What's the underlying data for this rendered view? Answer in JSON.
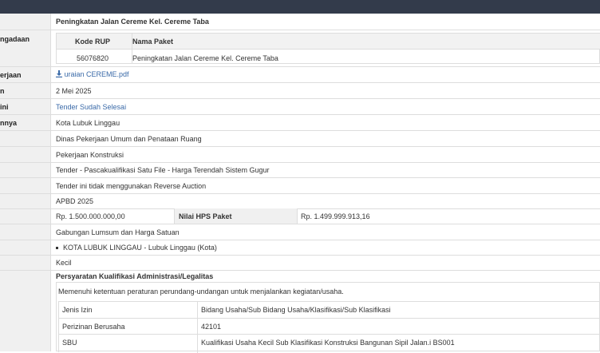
{
  "rows": {
    "nama_paket": "Peningkatan Jalan Cereme Kel. Cereme Taba",
    "rup_label": "ngadaan",
    "kode_rup_header": "Kode RUP",
    "nama_paket_header": "Nama Paket",
    "kode_rup_value": "56076820",
    "nama_paket_value": "Peningkatan Jalan Cereme Kel. Cereme Taba",
    "uraian_label": "erjaan",
    "uraian_file": "uraian CEREME.pdf",
    "tanggal_label": "n",
    "tanggal": "2 Mei 2025",
    "tahap_label": "ini",
    "tahap": "Tender Sudah Selesai",
    "instansi_label": "nnya",
    "instansi": "Kota Lubuk Linggau",
    "satker": "Dinas Pekerjaan Umum dan Penataan Ruang",
    "kategori": "Pekerjaan Konstruksi",
    "metode": "Tender - Pascakualifikasi Satu File - Harga Terendah Sistem Gugur",
    "reverse": "Tender ini tidak menggunakan Reverse Auction",
    "anggaran": "APBD 2025",
    "pagu": "Rp. 1.500.000.000,00",
    "hps_label": "Nilai HPS Paket",
    "hps": "Rp. 1.499.999.913,16",
    "kontrak": "Gabungan Lumsum dan Harga Satuan",
    "lokasi": "KOTA LUBUK LINGGAU - Lubuk Linggau (Kota)",
    "kualifikasi_usaha": "Kecil"
  },
  "syarat": {
    "title": "Persyaratan Kualifikasi Administrasi/Legalitas",
    "desc": "Memenuhi ketentuan peraturan perundang-undangan untuk menjalankan kegiatan/usaha.",
    "table": [
      {
        "col1": "Jenis Izin",
        "col2": "Bidang Usaha/Sub Bidang Usaha/Klasifikasi/Sub Klasifikasi"
      },
      {
        "col1": "Perizinan Berusaha",
        "col2": "42101"
      },
      {
        "col1": "SBU",
        "col2": "Kualifikasi Usaha Kecil Sub Klasifikasi Konstruksi Bangunan Sipil Jalan.i BS001"
      }
    ]
  },
  "colors": {
    "topbar": "#333b4b",
    "link": "#3a6aa8",
    "label_bg": "#f0f0f0",
    "border": "#dddddd"
  },
  "icons": {
    "download": "download-icon"
  }
}
